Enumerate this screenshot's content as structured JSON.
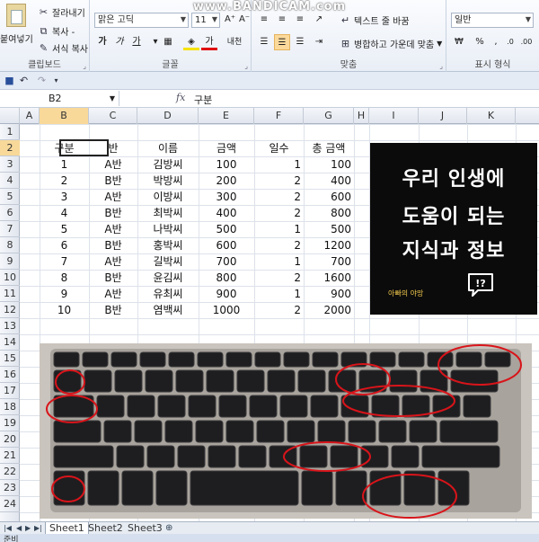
{
  "watermark": "www.BANDICAM.com",
  "ribbon": {
    "clipboard": {
      "paste_label": "붙여넣기",
      "cut_label": "잘라내기",
      "copy_label": "복사 -",
      "format_painter_label": "서식 복사",
      "group_label": "클립보드"
    },
    "font": {
      "font_name": "맑은 고딕",
      "font_size": "11",
      "bold_label": "가",
      "italic_label": "가",
      "underline_label": "가",
      "font_color_label": "가",
      "phonetic_label": "내천",
      "group_label": "글꼴"
    },
    "alignment": {
      "wrap_text_label": "텍스트 줄 바꿈",
      "merge_center_label": "병합하고 가운데 맞춤",
      "group_label": "맞춤"
    },
    "number": {
      "format_value": "일반",
      "group_label": "표시 형식"
    }
  },
  "formula_bar": {
    "cell_ref": "B2",
    "fx_label": "fx",
    "value": "구분"
  },
  "columns": [
    "A",
    "B",
    "C",
    "D",
    "E",
    "F",
    "G",
    "H",
    "I",
    "J",
    "K"
  ],
  "rows": [
    "1",
    "2",
    "3",
    "4",
    "5",
    "6",
    "7",
    "8",
    "9",
    "10",
    "11",
    "12",
    "13",
    "14",
    "15",
    "16",
    "17",
    "18",
    "19",
    "20",
    "21",
    "22",
    "23",
    "24"
  ],
  "table": {
    "headers": [
      "구분",
      "반",
      "이름",
      "금액",
      "일수",
      "총 금액"
    ],
    "rows": [
      [
        "1",
        "A반",
        "김방씨",
        "100",
        "1",
        "100"
      ],
      [
        "2",
        "B반",
        "박방씨",
        "200",
        "2",
        "400"
      ],
      [
        "3",
        "A반",
        "이방씨",
        "300",
        "2",
        "600"
      ],
      [
        "4",
        "B반",
        "최박씨",
        "400",
        "2",
        "800"
      ],
      [
        "5",
        "A반",
        "나박씨",
        "500",
        "1",
        "500"
      ],
      [
        "6",
        "B반",
        "홍박씨",
        "600",
        "2",
        "1200"
      ],
      [
        "7",
        "A반",
        "길박씨",
        "700",
        "1",
        "700"
      ],
      [
        "8",
        "B반",
        "윤김씨",
        "800",
        "2",
        "1600"
      ],
      [
        "9",
        "A반",
        "유최씨",
        "900",
        "1",
        "900"
      ],
      [
        "10",
        "B반",
        "염백씨",
        "1000",
        "2",
        "2000"
      ]
    ]
  },
  "info_card": {
    "line1": "우리 인생에",
    "line2": "도움이 되는",
    "line3": "지식과 정보",
    "brand": "아빠의 야망",
    "bubble_text": "!?"
  },
  "sheet_tabs": [
    "Sheet1",
    "Sheet2",
    "Sheet3"
  ],
  "status": "준비",
  "colors": {
    "selected_header": "#f8d99a",
    "card_background": "#0b0b0b",
    "highlight_circle": "#d8141a"
  }
}
